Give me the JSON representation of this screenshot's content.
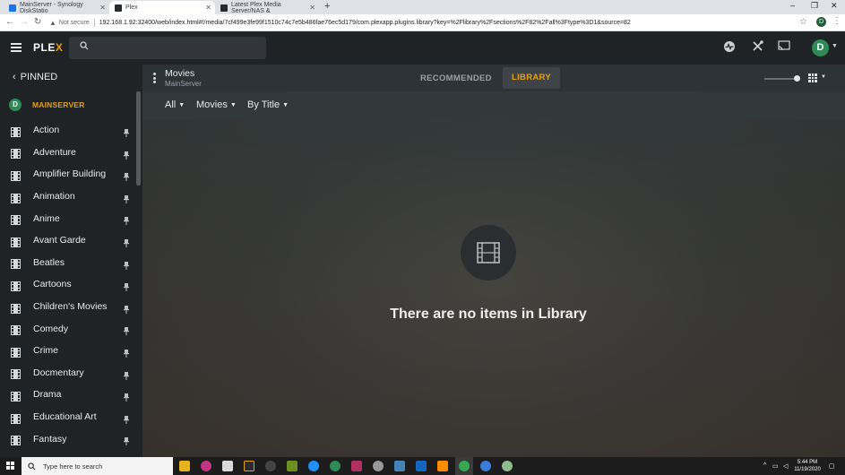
{
  "browser": {
    "tabs": [
      {
        "title": "MainServer - Synology DiskStatio",
        "color": "#1a73e8"
      },
      {
        "title": "Plex",
        "color": "#282a2d"
      },
      {
        "title": "Latest Plex Media Server/NAS &",
        "color": "#282a2d"
      }
    ],
    "new_tab": "+",
    "window_controls": {
      "minimize": "–",
      "maximize": "❐",
      "close": "✕"
    },
    "back": "←",
    "forward": "→",
    "reload": "↻",
    "security": "Not secure",
    "url": "192.168.1.92:32400/web/index.html#!/media/7cf499e3fe99f1510c74c7e5b486fae76ec5d179/com.plexapp.plugins.library?key=%2Flibrary%2Fsections%2F82%2Fall%3Ftype%3D1&source=82",
    "star": "☆",
    "profile_initial": "D",
    "menu": "⋮"
  },
  "plex": {
    "logo_main": "PLE",
    "logo_accent": "X",
    "accent_color": "#e5a00d",
    "user_initial": "D",
    "avatar_color": "#2e8b57",
    "icons": [
      "activity-icon",
      "settings-tools-icon",
      "cast-icon"
    ]
  },
  "sidebar": {
    "pinned_label": "PINNED",
    "server_initial": "D",
    "server_name": "MAINSERVER",
    "items": [
      {
        "label": "Action"
      },
      {
        "label": "Adventure"
      },
      {
        "label": "Amplifier Building"
      },
      {
        "label": "Animation"
      },
      {
        "label": "Anime"
      },
      {
        "label": "Avant Garde"
      },
      {
        "label": "Beatles"
      },
      {
        "label": "Cartoons"
      },
      {
        "label": "Children's Movies"
      },
      {
        "label": "Comedy"
      },
      {
        "label": "Crime"
      },
      {
        "label": "Docmentary"
      },
      {
        "label": "Drama"
      },
      {
        "label": "Educational Art"
      },
      {
        "label": "Fantasy"
      }
    ]
  },
  "main": {
    "title": "Movies",
    "subtitle": "MainServer",
    "tabs": {
      "recommended": "RECOMMENDED",
      "library": "LIBRARY"
    },
    "filters": {
      "all": "All",
      "type": "Movies",
      "sort": "By Title"
    },
    "empty_message": "There are no items in Library"
  },
  "taskbar": {
    "search_placeholder": "Type here to search",
    "time": "5:44 PM",
    "date": "11/19/2020"
  }
}
